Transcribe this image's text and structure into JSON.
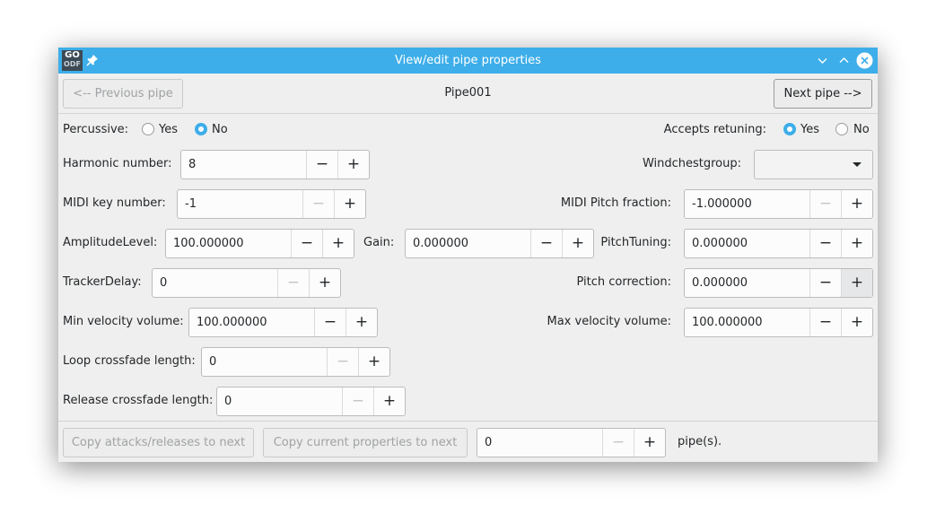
{
  "window": {
    "title": "View/edit pipe properties",
    "app_icon": {
      "line1": "GO",
      "line2": "ODF"
    }
  },
  "nav": {
    "previous_label": "<-- Previous pipe",
    "next_label": "Next pipe -->",
    "pipe_name": "Pipe001"
  },
  "percussive": {
    "label": "Percussive:",
    "yes": "Yes",
    "no": "No",
    "selected": "No"
  },
  "retuning": {
    "label": "Accepts retuning:",
    "yes": "Yes",
    "no": "No",
    "selected": "Yes"
  },
  "harmonic": {
    "label": "Harmonic number:",
    "value": "8"
  },
  "windchest": {
    "label": "Windchestgroup:",
    "value": ""
  },
  "midi_key": {
    "label": "MIDI key number:",
    "value": "-1"
  },
  "midi_pitch": {
    "label": "MIDI Pitch fraction:",
    "value": "-1.000000"
  },
  "amplitude": {
    "label": "AmplitudeLevel:",
    "value": "100.000000"
  },
  "gain": {
    "label": "Gain:",
    "value": "0.000000"
  },
  "pitch_tuning": {
    "label": "PitchTuning:",
    "value": "0.000000"
  },
  "tracker_delay": {
    "label": "TrackerDelay:",
    "value": "0"
  },
  "pitch_correction": {
    "label": "Pitch correction:",
    "value": "0.000000"
  },
  "min_velocity": {
    "label": "Min velocity volume:",
    "value": "100.000000"
  },
  "max_velocity": {
    "label": "Max velocity volume:",
    "value": "100.000000"
  },
  "loop_crossfade": {
    "label": "Loop crossfade length:",
    "value": "0"
  },
  "release_crossfade": {
    "label": "Release crossfade length:",
    "value": "0"
  },
  "footer": {
    "copy_attacks_label": "Copy attacks/releases to next",
    "copy_props_label": "Copy current properties to next",
    "count_value": "0",
    "suffix": "pipe(s)."
  },
  "spin_symbols": {
    "minus": "−",
    "plus": "+"
  },
  "colors": {
    "accent": "#3daee9",
    "window_bg": "#efefef"
  }
}
